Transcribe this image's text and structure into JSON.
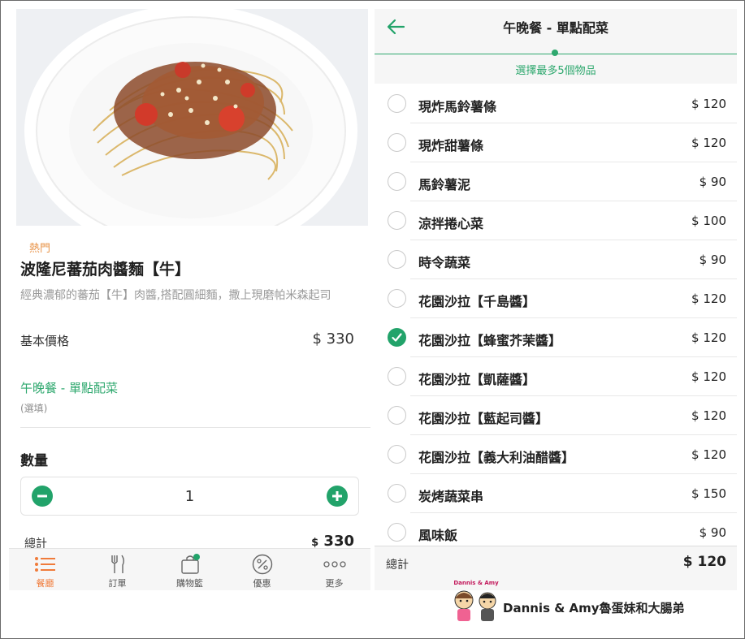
{
  "left": {
    "hot_tag": "熱門",
    "dish_name": "波隆尼蕃茄肉醬麵【牛】",
    "dish_desc": "經典濃郁的蕃茄【牛】肉醬,搭配圓細麵，撒上現磨帕米森起司",
    "base_price_label": "基本價格",
    "base_price_value": "$ 330",
    "addon_title": "午晚餐 - 單點配菜",
    "addon_optional": "(選填)",
    "qty_title": "數量",
    "qty_value": "1",
    "total_label": "總計",
    "total_currency": "$",
    "total_amount": "330",
    "tabs": [
      {
        "label": "餐廳",
        "icon": "list-icon"
      },
      {
        "label": "訂單",
        "icon": "fork-knife-icon"
      },
      {
        "label": "購物籃",
        "icon": "basket-icon"
      },
      {
        "label": "優惠",
        "icon": "percent-icon"
      },
      {
        "label": "更多",
        "icon": "more-icon"
      }
    ]
  },
  "right": {
    "title": "午晚餐 - 單點配菜",
    "subtitle": "選擇最多5個物品",
    "options": [
      {
        "name": "現炸馬鈴薯條",
        "price": "$ 120",
        "checked": false
      },
      {
        "name": "現炸甜薯條",
        "price": "$ 120",
        "checked": false
      },
      {
        "name": "馬鈴薯泥",
        "price": "$ 90",
        "checked": false
      },
      {
        "name": "涼拌捲心菜",
        "price": "$ 100",
        "checked": false
      },
      {
        "name": "時令蔬菜",
        "price": "$ 90",
        "checked": false
      },
      {
        "name": "花園沙拉【千島醬】",
        "price": "$ 120",
        "checked": false
      },
      {
        "name": "花園沙拉【蜂蜜芥茉醬】",
        "price": "$ 120",
        "checked": true
      },
      {
        "name": "花園沙拉【凱薩醬】",
        "price": "$ 120",
        "checked": false
      },
      {
        "name": "花園沙拉【藍起司醬】",
        "price": "$ 120",
        "checked": false
      },
      {
        "name": "花園沙拉【義大利油醋醬】",
        "price": "$ 120",
        "checked": false
      },
      {
        "name": "炭烤蔬菜串",
        "price": "$ 150",
        "checked": false
      },
      {
        "name": "風味飯",
        "price": "$ 90",
        "checked": false
      }
    ],
    "total_label": "總計",
    "total_value": "$ 120"
  },
  "watermark": {
    "logo_text": "Dannis & Amy",
    "text": "Dannis & Amy魯蛋妹和大腸弟"
  },
  "colors": {
    "accent_green": "#22a36a",
    "tag_orange": "#e8944a",
    "active_tab": "#f07b3a"
  }
}
